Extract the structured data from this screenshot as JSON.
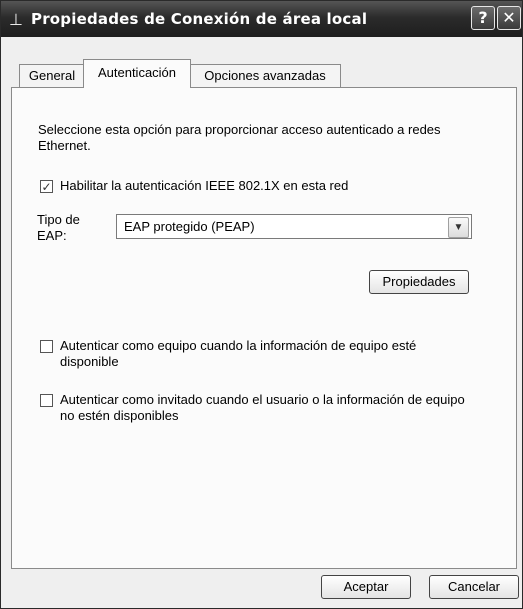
{
  "window": {
    "title": "Propiedades de Conexión de área local",
    "help_label": "?",
    "close_label": "✕",
    "icon_name": "network-connection-icon"
  },
  "tabs": [
    {
      "label": "General"
    },
    {
      "label": "Autenticación",
      "active": true
    },
    {
      "label": "Opciones avanzadas"
    }
  ],
  "auth": {
    "description": "Seleccione esta opción para proporcionar acceso autenticado a redes Ethernet.",
    "enable_8021x": {
      "label": "Habilitar la autenticación IEEE 802.1X en esta red",
      "checked": true
    },
    "eap_type_label": "Tipo de EAP:",
    "eap_type_value": "EAP protegido (PEAP)",
    "properties_button": "Propiedades",
    "auth_as_computer": {
      "label": "Autenticar como equipo cuando la información de equipo esté disponible",
      "checked": false
    },
    "auth_as_guest": {
      "label": "Autenticar como invitado cuando el usuario o la información de equipo no estén disponibles",
      "checked": false
    }
  },
  "footer": {
    "ok_label": "Aceptar",
    "cancel_label": "Cancelar"
  },
  "symbols": {
    "check": "✓",
    "dropdown": "▼"
  }
}
